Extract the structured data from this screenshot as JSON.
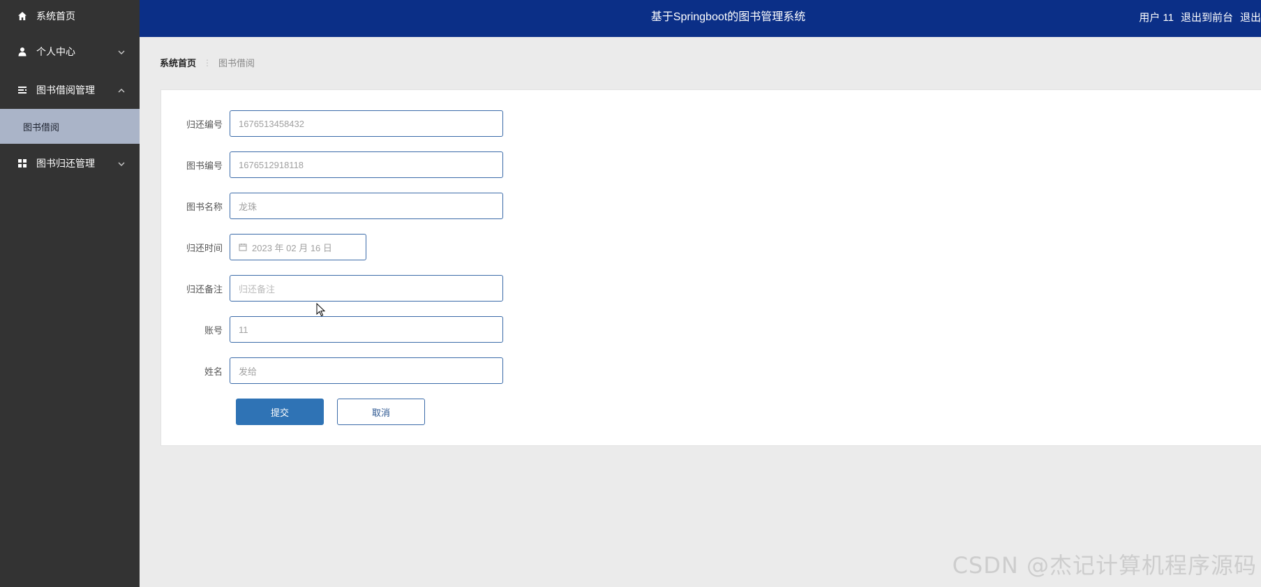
{
  "sidebar": {
    "items": [
      {
        "label": "系统首页",
        "icon": "home-icon"
      },
      {
        "label": "个人中心",
        "icon": "user-icon",
        "expanded": false
      },
      {
        "label": "图书借阅管理",
        "icon": "list-icon",
        "expanded": true,
        "children": [
          {
            "label": "图书借阅",
            "active": true
          }
        ]
      },
      {
        "label": "图书归还管理",
        "icon": "grid-icon",
        "expanded": false
      }
    ]
  },
  "header": {
    "title": "基于Springboot的图书管理系统",
    "user": "用户 11",
    "back_front": "退出到前台",
    "logout": "退出"
  },
  "breadcrumb": {
    "home": "系统首页",
    "current": "图书借阅"
  },
  "form": {
    "fields": [
      {
        "label": "归还编号",
        "value": "1676513458432"
      },
      {
        "label": "图书编号",
        "value": "1676512918118"
      },
      {
        "label": "图书名称",
        "value": "龙珠"
      },
      {
        "label": "归还时间",
        "value": "2023 年 02 月 16 日"
      },
      {
        "label": "归还备注",
        "placeholder": "归还备注"
      },
      {
        "label": "账号",
        "value": "11"
      },
      {
        "label": "姓名",
        "value": "发给"
      }
    ],
    "submit_label": "提交",
    "cancel_label": "取消"
  },
  "watermark": "CSDN @杰记计算机程序源码",
  "colors": {
    "sidebar_bg": "#333333",
    "topbar_bg": "#0b2f87",
    "active_sub_bg": "#aab4c8",
    "primary": "#2f73b5"
  }
}
